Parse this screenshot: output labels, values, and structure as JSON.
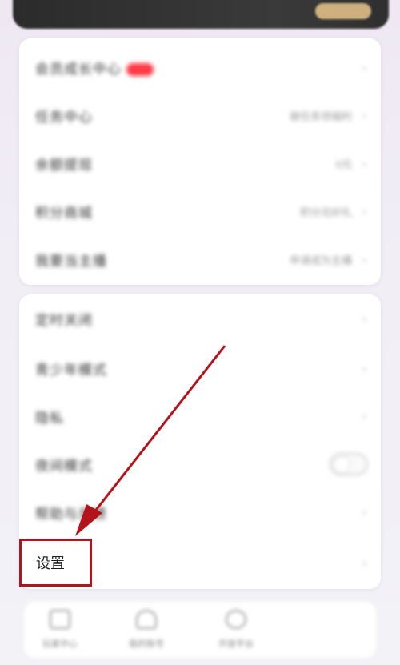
{
  "top_card": {
    "theme": "dark"
  },
  "card1": {
    "rows": [
      {
        "label": "会员成长中心",
        "value": "",
        "badge": true
      },
      {
        "label": "任务中心",
        "value": "做任务领福利"
      },
      {
        "label": "余额提现",
        "value": "0元"
      },
      {
        "label": "积分商城",
        "value": "积分兑好礼"
      },
      {
        "label": "我要当主播",
        "value": "申请成为主播"
      }
    ]
  },
  "card2": {
    "rows": [
      {
        "label": "定时关闭",
        "value": ""
      },
      {
        "label": "青少年模式",
        "value": ""
      },
      {
        "label": "隐私",
        "value": ""
      },
      {
        "label": "夜间模式",
        "value": "",
        "toggle": true
      },
      {
        "label": "帮助与反馈",
        "value": ""
      },
      {
        "label": "设置",
        "value": ""
      }
    ]
  },
  "bottom_nav": {
    "items": [
      {
        "label": "玩家中心",
        "icon": "grid-icon"
      },
      {
        "label": "我的账号",
        "icon": "person-icon"
      },
      {
        "label": "开放平台",
        "icon": "gear-icon"
      }
    ]
  },
  "annotation": {
    "color": "#b3141c"
  }
}
